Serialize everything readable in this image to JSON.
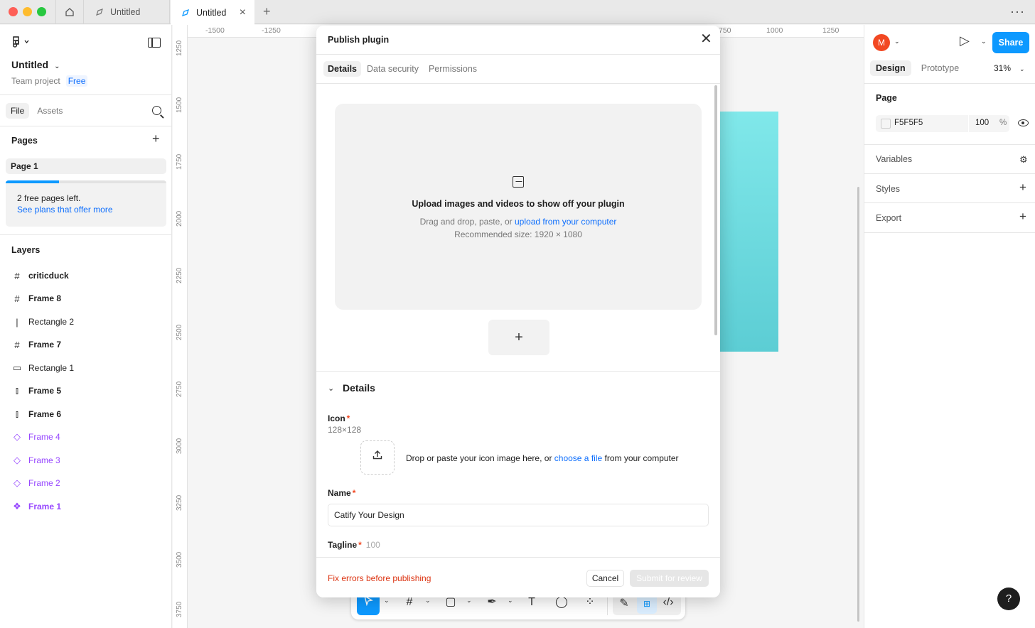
{
  "titlebar": {
    "tabs": [
      {
        "label": "Untitled",
        "active": false
      },
      {
        "label": "Untitled",
        "active": true
      }
    ]
  },
  "left": {
    "file_title": "Untitled",
    "team": "Team project",
    "plan_badge": "Free",
    "tabs": [
      "File",
      "Assets"
    ],
    "pages_heading": "Pages",
    "pages": [
      "Page 1"
    ],
    "free_pages_progress": 0.33,
    "free_pages_text": "2 free pages left.",
    "free_pages_link": "See plans that offer more",
    "layers_heading": "Layers",
    "layers": [
      {
        "name": "criticduck",
        "icon": "frame-icon"
      },
      {
        "name": "Frame 8",
        "icon": "frame-icon"
      },
      {
        "name": "Rectangle 2",
        "icon": "line-icon"
      },
      {
        "name": "Frame 7",
        "icon": "frame-icon"
      },
      {
        "name": "Rectangle 1",
        "icon": "rectangle-icon"
      },
      {
        "name": "Frame 5",
        "icon": "auto-layout-icon"
      },
      {
        "name": "Frame 6",
        "icon": "auto-layout-icon"
      },
      {
        "name": "Frame 4",
        "icon": "instance-icon"
      },
      {
        "name": "Frame 3",
        "icon": "instance-icon"
      },
      {
        "name": "Frame 2",
        "icon": "instance-icon"
      },
      {
        "name": "Frame 1",
        "icon": "component-icon"
      }
    ]
  },
  "canvas": {
    "ruler_top": [
      "-1500",
      "-1250",
      "750",
      "1000",
      "1250"
    ],
    "ruler_left": [
      "1250",
      "1500",
      "1750",
      "2000",
      "2250",
      "2500",
      "2750",
      "3000",
      "3250",
      "3500",
      "3750"
    ],
    "frame_color": "#80e8ea"
  },
  "right": {
    "avatar_letter": "M",
    "share": "Share",
    "tabs": [
      "Design",
      "Prototype"
    ],
    "zoom": "31%",
    "page_label": "Page",
    "page_color": "F5F5F5",
    "page_opacity": "100",
    "page_opacity_unit": "%",
    "variables": "Variables",
    "styles": "Styles",
    "export": "Export",
    "help": "?"
  },
  "modal": {
    "title": "Publish plugin",
    "tabs": [
      "Details",
      "Data security",
      "Permissions"
    ],
    "upload_heading": "Upload images and videos to show off your plugin",
    "upload_sub_prefix": "Drag and drop, paste, or ",
    "upload_sub_link": "upload from your computer",
    "upload_recommended": "Recommended size: 1920 × 1080",
    "section_title": "Details",
    "icon_label": "Icon",
    "icon_size": "128×128",
    "icon_drop_prefix": "Drop or paste your icon image here, or ",
    "icon_drop_link": "choose a file",
    "icon_drop_suffix": " from your computer",
    "name_label": "Name",
    "name_value": "Catify Your Design",
    "tagline_label": "Tagline",
    "tagline_limit": "100",
    "required_mark": "*",
    "error": "Fix errors before publishing",
    "cancel": "Cancel",
    "submit": "Submit for review"
  }
}
